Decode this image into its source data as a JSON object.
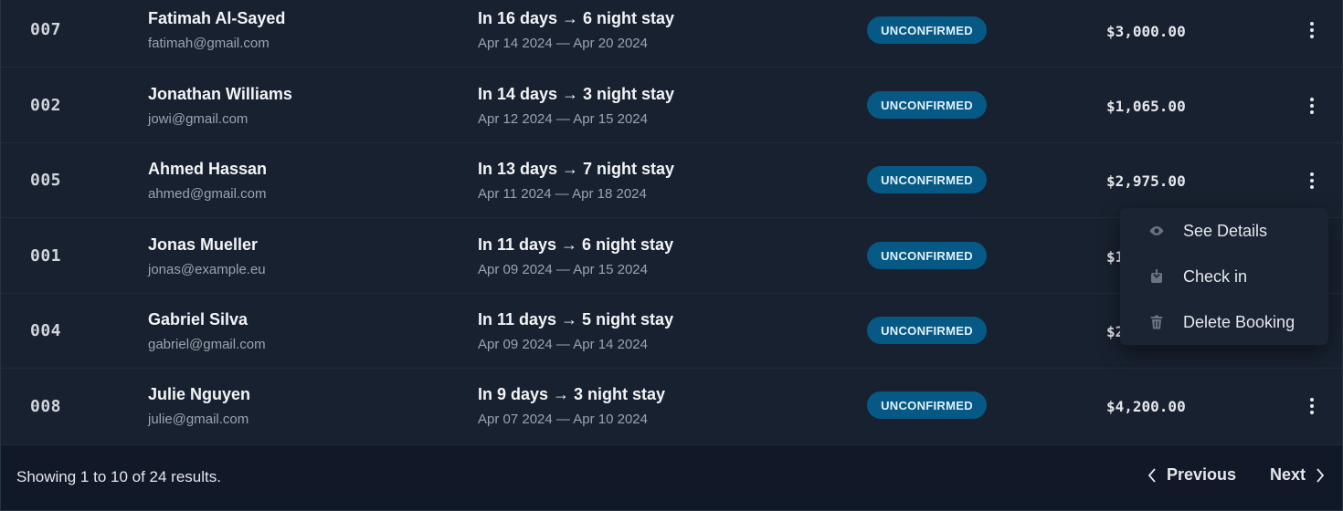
{
  "rows": [
    {
      "id": "007",
      "name": "Fatimah Al-Sayed",
      "email": "fatimah@gmail.com",
      "stay": "In 16 days → 6 night stay",
      "range": "Apr 14 2024 — Apr 20 2024",
      "status": "UNCONFIRMED",
      "amount": "$3,000.00"
    },
    {
      "id": "002",
      "name": "Jonathan Williams",
      "email": "jowi@gmail.com",
      "stay": "In 14 days → 3 night stay",
      "range": "Apr 12 2024 — Apr 15 2024",
      "status": "UNCONFIRMED",
      "amount": "$1,065.00"
    },
    {
      "id": "005",
      "name": "Ahmed Hassan",
      "email": "ahmed@gmail.com",
      "stay": "In 13 days → 7 night stay",
      "range": "Apr 11 2024 — Apr 18 2024",
      "status": "UNCONFIRMED",
      "amount": "$2,975.00"
    },
    {
      "id": "001",
      "name": "Jonas Mueller",
      "email": "jonas@example.eu",
      "stay": "In 11 days → 6 night stay",
      "range": "Apr 09 2024 — Apr 15 2024",
      "status": "UNCONFIRMED",
      "amount": "$1"
    },
    {
      "id": "004",
      "name": "Gabriel Silva",
      "email": "gabriel@gmail.com",
      "stay": "In 11 days → 5 night stay",
      "range": "Apr 09 2024 — Apr 14 2024",
      "status": "UNCONFIRMED",
      "amount": "$2"
    },
    {
      "id": "008",
      "name": "Julie Nguyen",
      "email": "julie@gmail.com",
      "stay": "In 9 days → 3 night stay",
      "range": "Apr 07 2024 — Apr 10 2024",
      "status": "UNCONFIRMED",
      "amount": "$4,200.00"
    }
  ],
  "menu": {
    "see_details": "See Details",
    "check_in": "Check in",
    "delete_booking": "Delete Booking"
  },
  "footer": {
    "results": "Showing 1 to 10 of 24 results.",
    "previous": "Previous",
    "next": "Next"
  },
  "colors": {
    "badge_bg": "#075985",
    "background": "#18212f"
  },
  "icons": {
    "menu_trigger": "kebab-vertical-icon",
    "see_details": "eye-icon",
    "check_in": "check-in-icon",
    "delete_booking": "trash-icon",
    "previous": "chevron-left-icon",
    "next": "chevron-right-icon"
  }
}
